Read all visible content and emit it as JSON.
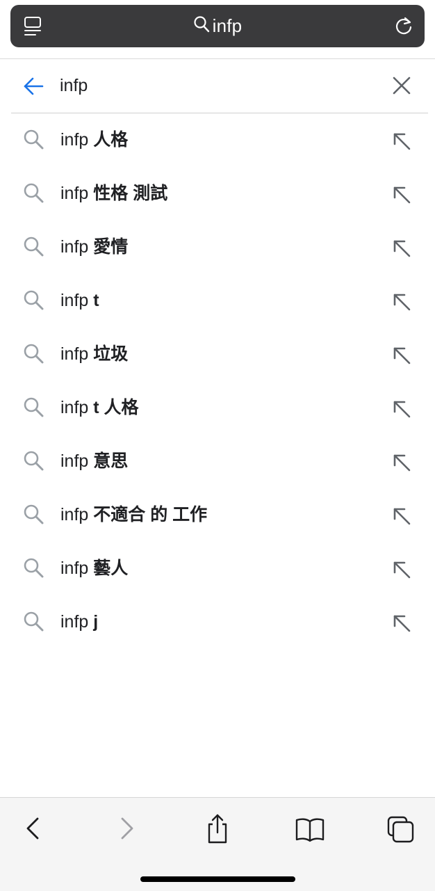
{
  "address_bar": {
    "query": "infp",
    "left_icon": "reader-list-icon",
    "right_icon": "reload-icon"
  },
  "search": {
    "value": "infp",
    "back_icon": "back-arrow-icon",
    "clear_icon": "close-icon",
    "accent_color": "#1a73e8"
  },
  "suggestions": [
    {
      "base": "infp",
      "rest": "人格"
    },
    {
      "base": "infp",
      "rest": "性格 測試"
    },
    {
      "base": "infp",
      "rest": "愛情"
    },
    {
      "base": "infp",
      "rest": "t"
    },
    {
      "base": "infp",
      "rest": "垃圾"
    },
    {
      "base": "infp",
      "rest": "t 人格"
    },
    {
      "base": "infp",
      "rest": "意思"
    },
    {
      "base": "infp",
      "rest": "不適合 的 工作"
    },
    {
      "base": "infp",
      "rest": "藝人"
    },
    {
      "base": "infp",
      "rest": "j"
    }
  ],
  "toolbar": {
    "items": [
      "back-icon",
      "forward-icon",
      "share-icon",
      "bookmarks-icon",
      "tabs-icon"
    ]
  }
}
